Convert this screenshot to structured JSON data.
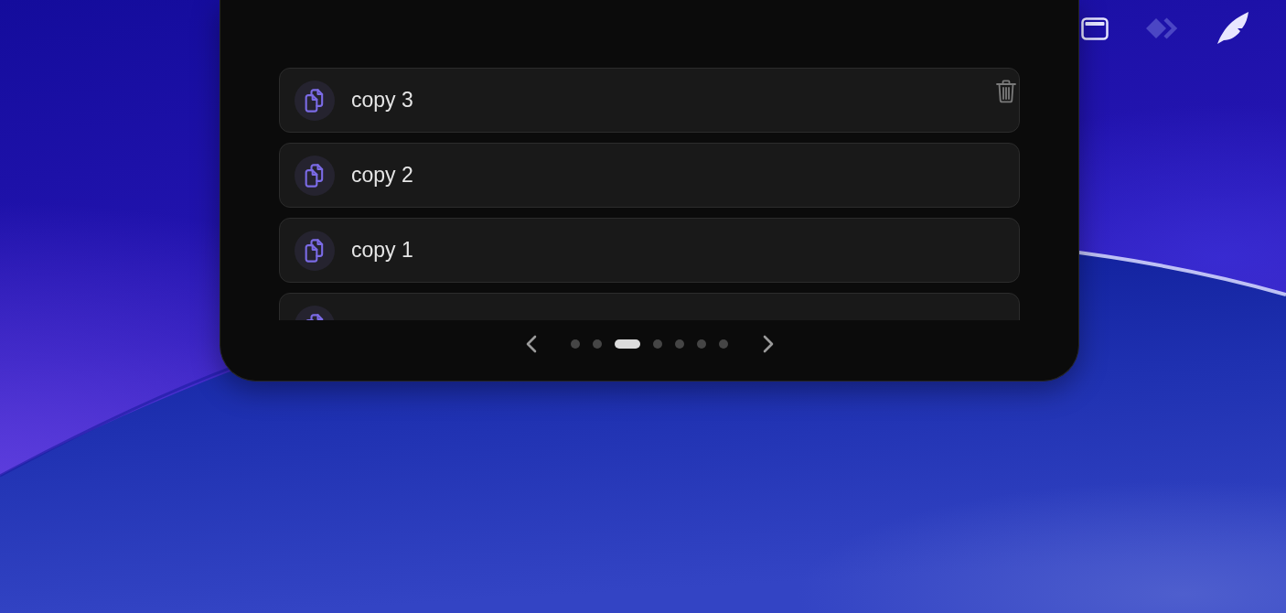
{
  "clipboard_list": {
    "items": [
      {
        "label": "copy 3",
        "delete_visible": true
      },
      {
        "label": "copy 2",
        "delete_visible": false
      },
      {
        "label": "copy 1",
        "delete_visible": false
      },
      {
        "delete_visible": false
      }
    ]
  },
  "pagination": {
    "pages": [
      {
        "selected": false
      },
      {
        "selected": false
      },
      {
        "selected": true
      },
      {
        "selected": false
      },
      {
        "selected": false
      },
      {
        "selected": false
      },
      {
        "selected": false
      }
    ]
  }
}
